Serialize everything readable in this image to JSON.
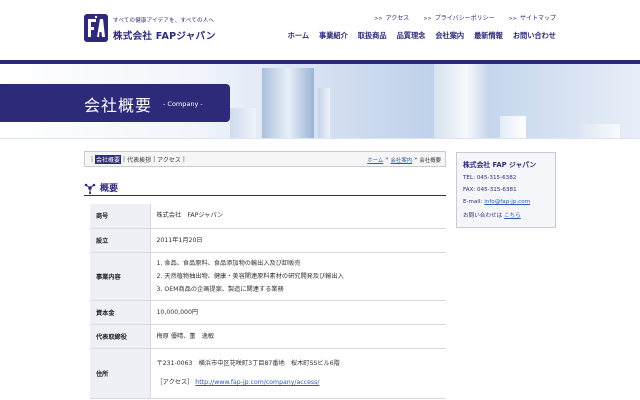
{
  "header": {
    "logo_tagline": "すべての健康アイデアを、すべての人へ",
    "logo_name": "株式会社 FAPジャパン",
    "util_nav": [
      {
        "label": "アクセス"
      },
      {
        "label": "プライバシーポリシー"
      },
      {
        "label": "サイトマップ"
      }
    ],
    "main_nav": [
      {
        "label": "ホーム"
      },
      {
        "label": "事業紹介"
      },
      {
        "label": "取扱商品"
      },
      {
        "label": "品質理念"
      },
      {
        "label": "会社案内"
      },
      {
        "label": "最新情報"
      },
      {
        "label": "お問い合わせ"
      }
    ]
  },
  "hero": {
    "title": "会社概要",
    "subtitle": "- Company -"
  },
  "subnav": {
    "items": [
      {
        "label": "会社概要",
        "active": true
      },
      {
        "label": "代表挨拶"
      },
      {
        "label": "アクセス"
      }
    ],
    "sep": "|"
  },
  "breadcrumb": {
    "items": [
      "ホーム",
      "会社案内",
      "会社概要"
    ],
    "sep": "»"
  },
  "section": {
    "title": "概要"
  },
  "table": {
    "rows": [
      {
        "label": "商号",
        "lines": [
          "株式会社　FAPジャパン"
        ]
      },
      {
        "label": "設立",
        "lines": [
          "2011年1月20日"
        ]
      },
      {
        "label": "事業内容",
        "lines": [
          "1. 食品、食品原料、食品添加物の輸出入及び卸販売",
          "2. 天然植物抽出物、健康・美容関連原料素材の研究開発及び輸出入",
          "3. OEM商品の企画提案、製造に関連する業務"
        ]
      },
      {
        "label": "資本金",
        "lines": [
          "10,000,000円"
        ]
      },
      {
        "label": "代表取締役",
        "lines": [
          "梅原 優晴、董　逸敏"
        ]
      },
      {
        "label": "住所",
        "lines": [
          "〒231-0063　横浜市中区花咲町3丁目87番地　桜木町SSビル6階"
        ],
        "access_label": "［アクセス］",
        "access_url": "http://www.fap-jp.com/company/access/"
      }
    ]
  },
  "sidebar": {
    "title": "株式会社 FAP ジャパン",
    "tel": "TEL: 045-315-6382",
    "fax": "FAX: 045-315-6381",
    "email_label": "E-mail:",
    "email": "info@fap-jp.com",
    "contact_label": "お問い合わせは",
    "contact_link": "こちら"
  },
  "colors": {
    "brand": "#2e2a7a",
    "link": "#2e5ab0"
  }
}
